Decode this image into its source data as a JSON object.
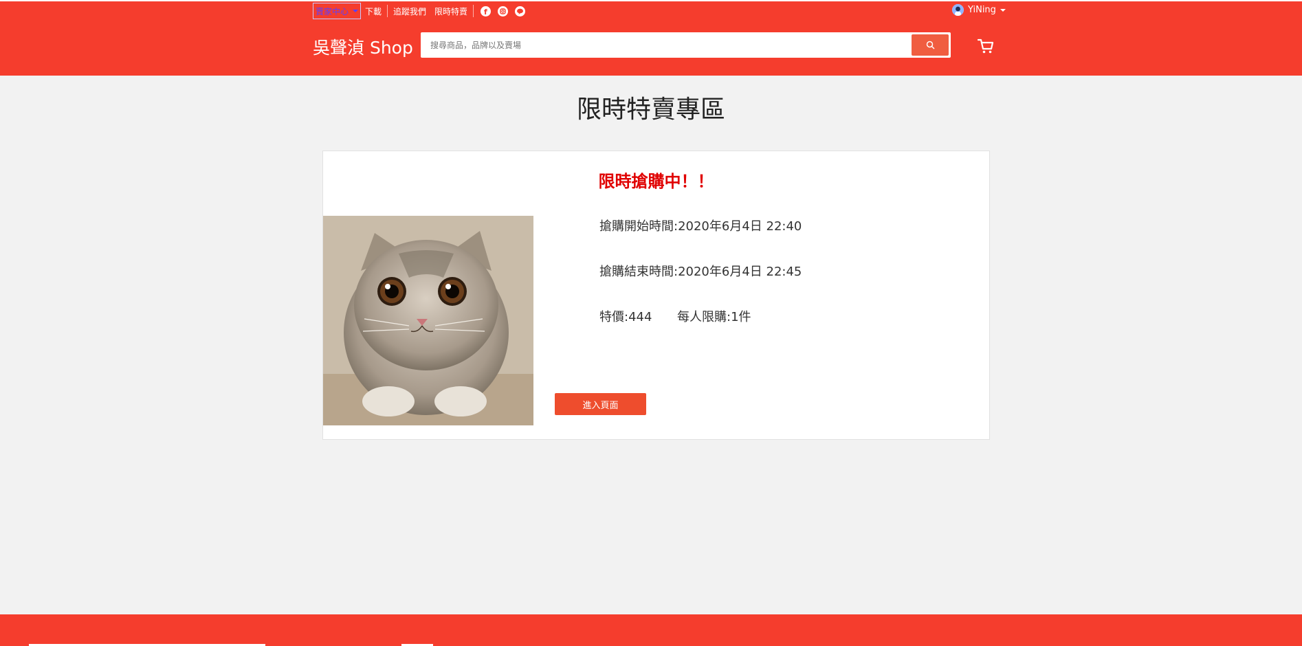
{
  "topbar": {
    "seller_center": "賣家中心",
    "download": "下載",
    "follow_us": "追蹤我們",
    "flash_sale": "限時特賣",
    "social_icons": [
      "facebook-icon",
      "instagram-icon",
      "line-icon"
    ],
    "username": "YiNing"
  },
  "header": {
    "brand": "吳聲湞 Shop",
    "search_placeholder": "搜尋商品，品牌以及賣場"
  },
  "page": {
    "title": "限時特賣專區"
  },
  "sale": {
    "status": "限時搶購中！！",
    "start_time": "搶購開始時間:2020年6月4日 22:40",
    "end_time": "搶購結束時間:2020年6月4日 22:45",
    "price": "特價:444",
    "limit": "每人限購:1件",
    "enter_button": "進入頁面"
  },
  "colors": {
    "brand_red": "#f53d2d",
    "button_red": "#ee4d2d",
    "flash_text": "#e00000",
    "background": "#f2f2f2"
  }
}
